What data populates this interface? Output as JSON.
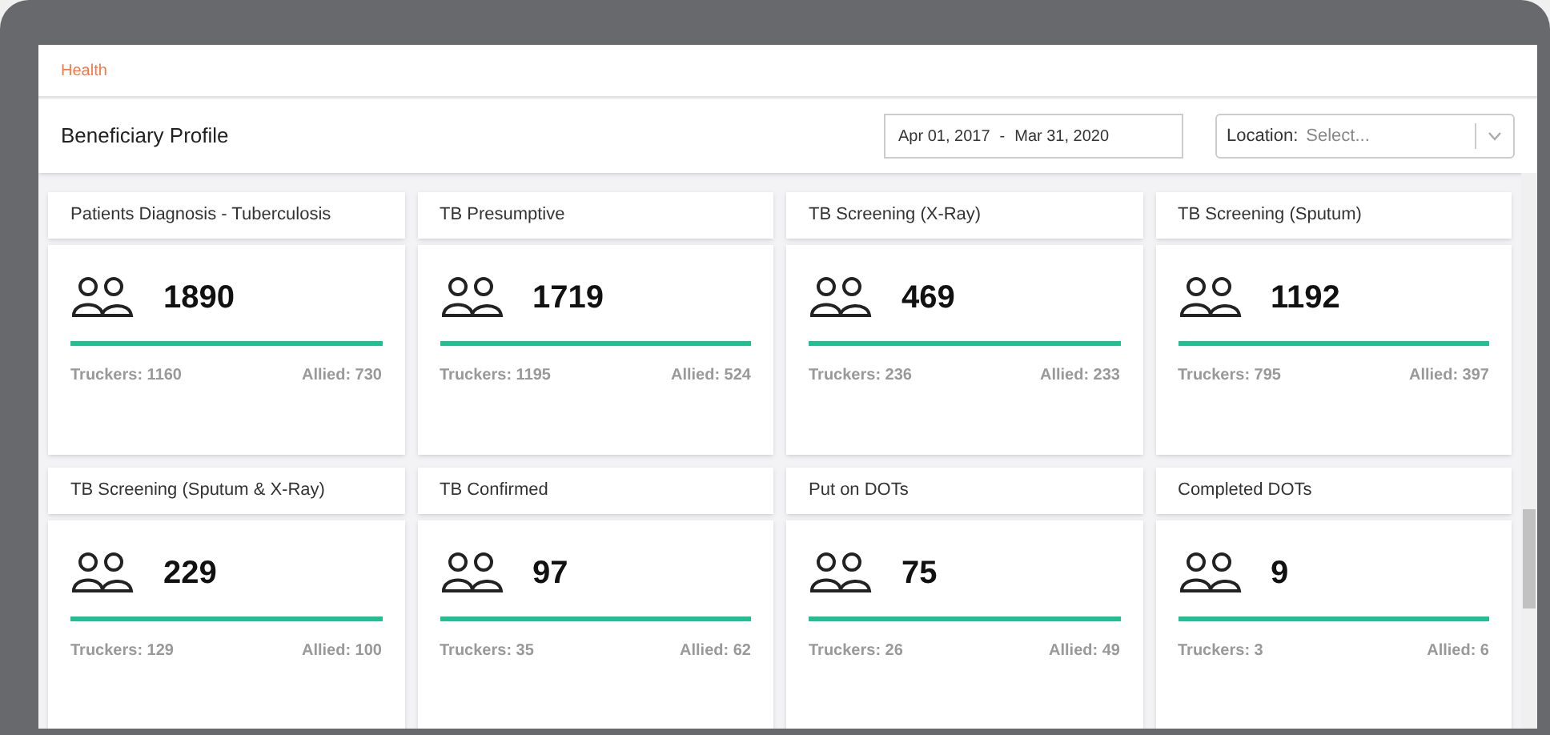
{
  "breadcrumb": "Health",
  "title": "Beneficiary Profile",
  "date_range": {
    "start": "Apr 01, 2017",
    "separator": "-",
    "end": "Mar 31, 2020"
  },
  "location": {
    "label": "Location:",
    "placeholder": "Select..."
  },
  "cards": [
    {
      "title": "Patients Diagnosis - Tuberculosis",
      "total": "1890",
      "truckers": "Truckers: 1160",
      "allied": "Allied: 730"
    },
    {
      "title": "TB Presumptive",
      "total": "1719",
      "truckers": "Truckers: 1195",
      "allied": "Allied: 524"
    },
    {
      "title": "TB Screening (X-Ray)",
      "total": "469",
      "truckers": "Truckers: 236",
      "allied": "Allied: 233"
    },
    {
      "title": "TB Screening (Sputum)",
      "total": "1192",
      "truckers": "Truckers: 795",
      "allied": "Allied: 397"
    },
    {
      "title": "TB Screening (Sputum & X-Ray)",
      "total": "229",
      "truckers": "Truckers: 129",
      "allied": "Allied: 100"
    },
    {
      "title": "TB Confirmed",
      "total": "97",
      "truckers": "Truckers: 35",
      "allied": "Allied: 62"
    },
    {
      "title": "Put on DOTs",
      "total": "75",
      "truckers": "Truckers: 26",
      "allied": "Allied: 49"
    },
    {
      "title": "Completed DOTs",
      "total": "9",
      "truckers": "Truckers: 3",
      "allied": "Allied: 6"
    }
  ]
}
